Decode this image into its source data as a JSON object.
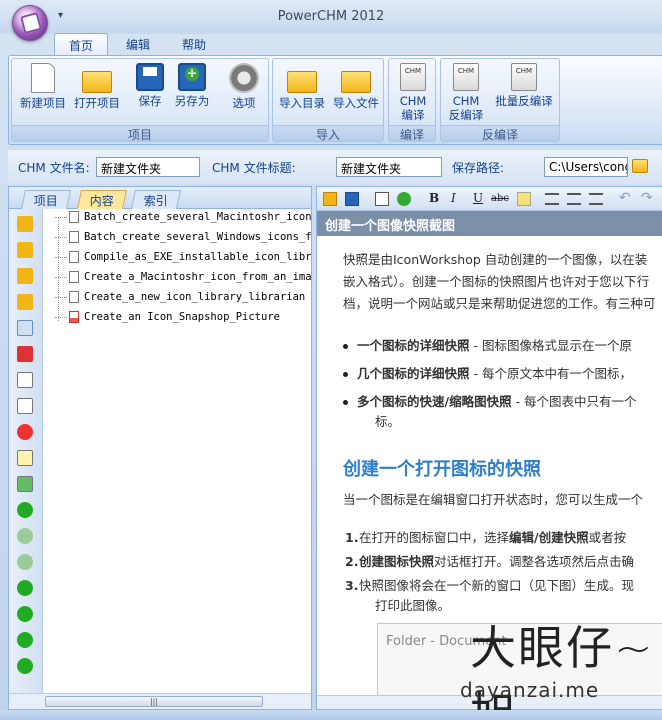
{
  "window": {
    "title": "PowerCHM 2012"
  },
  "ribbon_tabs": [
    "首页",
    "编辑",
    "帮助"
  ],
  "groups": {
    "project": {
      "title": "项目",
      "buttons": [
        "新建项目",
        "打开项目",
        "保存",
        "另存为",
        "选项"
      ]
    },
    "import": {
      "title": "导入",
      "buttons": [
        "导入目录",
        "导入文件"
      ]
    },
    "compile": {
      "title": "编译",
      "buttons": [
        "CHM\n编译"
      ]
    },
    "decompile": {
      "title": "反编译",
      "buttons": [
        "CHM\n反编译",
        "批量反编译"
      ]
    }
  },
  "path_bar": {
    "file_name_label": "CHM 文件名:",
    "file_name_value": "新建文件夹",
    "file_title_label": "CHM 文件标题:",
    "file_title_value": "新建文件夹",
    "save_path_label": "保存路径:",
    "save_path_value": "C:\\Users\\cong"
  },
  "panel_tabs": [
    "项目",
    "内容",
    "索引"
  ],
  "tree_items": [
    "Batch_create_several_Macintoshr_icons_",
    "Batch_create_several_Windows_icons_fro",
    "Compile_as_EXE_installable_icon_librar",
    "Create_a_Macintoshr_icon_from_an_image",
    "Create_a_new_icon_library_librarian",
    "Create_an Icon_Snapshop_Picture"
  ],
  "editor_toolbar": [
    "B",
    "I",
    "U",
    "abc"
  ],
  "document": {
    "header": "创建一个图像快照截图",
    "intro": [
      "快照是由IconWorkshop 自动创建的一个图像，以在装",
      "嵌入格式）。创建一个图标的快照图片也许对于您以下行",
      "档，说明一个网站或只是来帮助促进您的工作。有三种可"
    ],
    "bullets": [
      {
        "bold": "一个图标的详细快照",
        "text": " - 图标图像格式显示在一个原"
      },
      {
        "bold": "几个图标的详细快照",
        "text": " - 每个原文本中有一个图标，"
      },
      {
        "bold": "多个图标的快速/缩略图快照",
        "text": " - 每个图表中只有一个",
        "cont": "标。"
      }
    ],
    "heading2": "创建一个打开图标的快照",
    "para2": "当一个图标是在编辑窗口打开状态时，您可以生成一个",
    "steps": [
      {
        "n": "1.",
        "text": "在打开的图标窗口中，选择",
        "bold": "编辑/创建快照",
        "tail": "或者按"
      },
      {
        "n": "2.",
        "text": "",
        "bold": "创建图标快照",
        "tail": "对话框打开。调整各选项然后点击确"
      },
      {
        "n": "3.",
        "text": "快照图像将会在一个新的窗口（见下图）生成。现",
        "bold": "",
        "tail": "",
        "cont": "打印此图像。"
      }
    ],
    "preview_label": "Folder - Document"
  },
  "watermark": {
    "big": "大眼仔~旭",
    "small": "dayanzai.me"
  }
}
